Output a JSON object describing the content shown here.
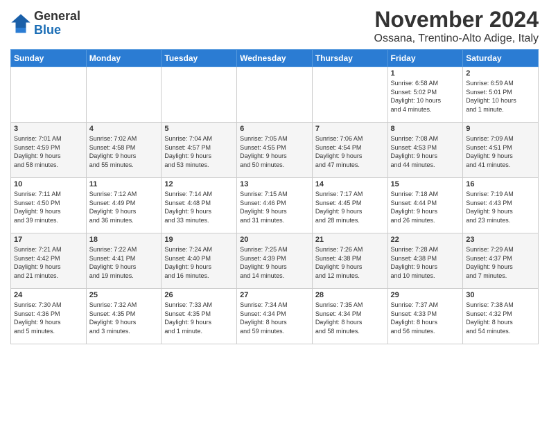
{
  "header": {
    "logo_general": "General",
    "logo_blue": "Blue",
    "month_title": "November 2024",
    "location": "Ossana, Trentino-Alto Adige, Italy"
  },
  "calendar": {
    "days_of_week": [
      "Sunday",
      "Monday",
      "Tuesday",
      "Wednesday",
      "Thursday",
      "Friday",
      "Saturday"
    ],
    "weeks": [
      [
        {
          "day": "",
          "info": ""
        },
        {
          "day": "",
          "info": ""
        },
        {
          "day": "",
          "info": ""
        },
        {
          "day": "",
          "info": ""
        },
        {
          "day": "",
          "info": ""
        },
        {
          "day": "1",
          "info": "Sunrise: 6:58 AM\nSunset: 5:02 PM\nDaylight: 10 hours\nand 4 minutes."
        },
        {
          "day": "2",
          "info": "Sunrise: 6:59 AM\nSunset: 5:01 PM\nDaylight: 10 hours\nand 1 minute."
        }
      ],
      [
        {
          "day": "3",
          "info": "Sunrise: 7:01 AM\nSunset: 4:59 PM\nDaylight: 9 hours\nand 58 minutes."
        },
        {
          "day": "4",
          "info": "Sunrise: 7:02 AM\nSunset: 4:58 PM\nDaylight: 9 hours\nand 55 minutes."
        },
        {
          "day": "5",
          "info": "Sunrise: 7:04 AM\nSunset: 4:57 PM\nDaylight: 9 hours\nand 53 minutes."
        },
        {
          "day": "6",
          "info": "Sunrise: 7:05 AM\nSunset: 4:55 PM\nDaylight: 9 hours\nand 50 minutes."
        },
        {
          "day": "7",
          "info": "Sunrise: 7:06 AM\nSunset: 4:54 PM\nDaylight: 9 hours\nand 47 minutes."
        },
        {
          "day": "8",
          "info": "Sunrise: 7:08 AM\nSunset: 4:53 PM\nDaylight: 9 hours\nand 44 minutes."
        },
        {
          "day": "9",
          "info": "Sunrise: 7:09 AM\nSunset: 4:51 PM\nDaylight: 9 hours\nand 41 minutes."
        }
      ],
      [
        {
          "day": "10",
          "info": "Sunrise: 7:11 AM\nSunset: 4:50 PM\nDaylight: 9 hours\nand 39 minutes."
        },
        {
          "day": "11",
          "info": "Sunrise: 7:12 AM\nSunset: 4:49 PM\nDaylight: 9 hours\nand 36 minutes."
        },
        {
          "day": "12",
          "info": "Sunrise: 7:14 AM\nSunset: 4:48 PM\nDaylight: 9 hours\nand 33 minutes."
        },
        {
          "day": "13",
          "info": "Sunrise: 7:15 AM\nSunset: 4:46 PM\nDaylight: 9 hours\nand 31 minutes."
        },
        {
          "day": "14",
          "info": "Sunrise: 7:17 AM\nSunset: 4:45 PM\nDaylight: 9 hours\nand 28 minutes."
        },
        {
          "day": "15",
          "info": "Sunrise: 7:18 AM\nSunset: 4:44 PM\nDaylight: 9 hours\nand 26 minutes."
        },
        {
          "day": "16",
          "info": "Sunrise: 7:19 AM\nSunset: 4:43 PM\nDaylight: 9 hours\nand 23 minutes."
        }
      ],
      [
        {
          "day": "17",
          "info": "Sunrise: 7:21 AM\nSunset: 4:42 PM\nDaylight: 9 hours\nand 21 minutes."
        },
        {
          "day": "18",
          "info": "Sunrise: 7:22 AM\nSunset: 4:41 PM\nDaylight: 9 hours\nand 19 minutes."
        },
        {
          "day": "19",
          "info": "Sunrise: 7:24 AM\nSunset: 4:40 PM\nDaylight: 9 hours\nand 16 minutes."
        },
        {
          "day": "20",
          "info": "Sunrise: 7:25 AM\nSunset: 4:39 PM\nDaylight: 9 hours\nand 14 minutes."
        },
        {
          "day": "21",
          "info": "Sunrise: 7:26 AM\nSunset: 4:38 PM\nDaylight: 9 hours\nand 12 minutes."
        },
        {
          "day": "22",
          "info": "Sunrise: 7:28 AM\nSunset: 4:38 PM\nDaylight: 9 hours\nand 10 minutes."
        },
        {
          "day": "23",
          "info": "Sunrise: 7:29 AM\nSunset: 4:37 PM\nDaylight: 9 hours\nand 7 minutes."
        }
      ],
      [
        {
          "day": "24",
          "info": "Sunrise: 7:30 AM\nSunset: 4:36 PM\nDaylight: 9 hours\nand 5 minutes."
        },
        {
          "day": "25",
          "info": "Sunrise: 7:32 AM\nSunset: 4:35 PM\nDaylight: 9 hours\nand 3 minutes."
        },
        {
          "day": "26",
          "info": "Sunrise: 7:33 AM\nSunset: 4:35 PM\nDaylight: 9 hours\nand 1 minute."
        },
        {
          "day": "27",
          "info": "Sunrise: 7:34 AM\nSunset: 4:34 PM\nDaylight: 8 hours\nand 59 minutes."
        },
        {
          "day": "28",
          "info": "Sunrise: 7:35 AM\nSunset: 4:34 PM\nDaylight: 8 hours\nand 58 minutes."
        },
        {
          "day": "29",
          "info": "Sunrise: 7:37 AM\nSunset: 4:33 PM\nDaylight: 8 hours\nand 56 minutes."
        },
        {
          "day": "30",
          "info": "Sunrise: 7:38 AM\nSunset: 4:32 PM\nDaylight: 8 hours\nand 54 minutes."
        }
      ]
    ]
  }
}
